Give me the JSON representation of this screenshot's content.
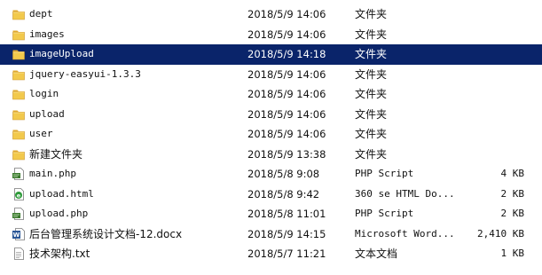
{
  "colors": {
    "selection": "#0a246a",
    "folder_body": "#f2c94c",
    "folder_tab": "#e0a82e"
  },
  "files": [
    {
      "icon": "folder-icon",
      "name": "dept",
      "date": "2018/5/9 14:06",
      "type": "文件夹",
      "size": ""
    },
    {
      "icon": "folder-icon",
      "name": "images",
      "date": "2018/5/9 14:06",
      "type": "文件夹",
      "size": ""
    },
    {
      "icon": "folder-icon",
      "name": "imageUpload",
      "date": "2018/5/9 14:18",
      "type": "文件夹",
      "size": "",
      "selected": true
    },
    {
      "icon": "folder-icon",
      "name": "jquery-easyui-1.3.3",
      "date": "2018/5/9 14:06",
      "type": "文件夹",
      "size": ""
    },
    {
      "icon": "folder-icon",
      "name": "login",
      "date": "2018/5/9 14:06",
      "type": "文件夹",
      "size": ""
    },
    {
      "icon": "folder-icon",
      "name": "upload",
      "date": "2018/5/9 14:06",
      "type": "文件夹",
      "size": ""
    },
    {
      "icon": "folder-icon",
      "name": "user",
      "date": "2018/5/9 14:06",
      "type": "文件夹",
      "size": ""
    },
    {
      "icon": "folder-icon",
      "name": "新建文件夹",
      "date": "2018/5/9 13:38",
      "type": "文件夹",
      "size": ""
    },
    {
      "icon": "php-file-icon",
      "name": "main.php",
      "date": "2018/5/8 9:08",
      "type": "PHP Script",
      "size": "4 KB"
    },
    {
      "icon": "html-file-icon",
      "name": "upload.html",
      "date": "2018/5/8 9:42",
      "type": "360 se HTML Do...",
      "size": "2 KB"
    },
    {
      "icon": "php-file-icon",
      "name": "upload.php",
      "date": "2018/5/8 11:01",
      "type": "PHP Script",
      "size": "2 KB"
    },
    {
      "icon": "word-file-icon",
      "name": "后台管理系统设计文档-12.docx",
      "date": "2018/5/9 14:15",
      "type": "Microsoft Word...",
      "size": "2,410 KB"
    },
    {
      "icon": "text-file-icon",
      "name": "技术架构.txt",
      "date": "2018/5/7 11:21",
      "type": "文本文档",
      "size": "1 KB"
    }
  ]
}
